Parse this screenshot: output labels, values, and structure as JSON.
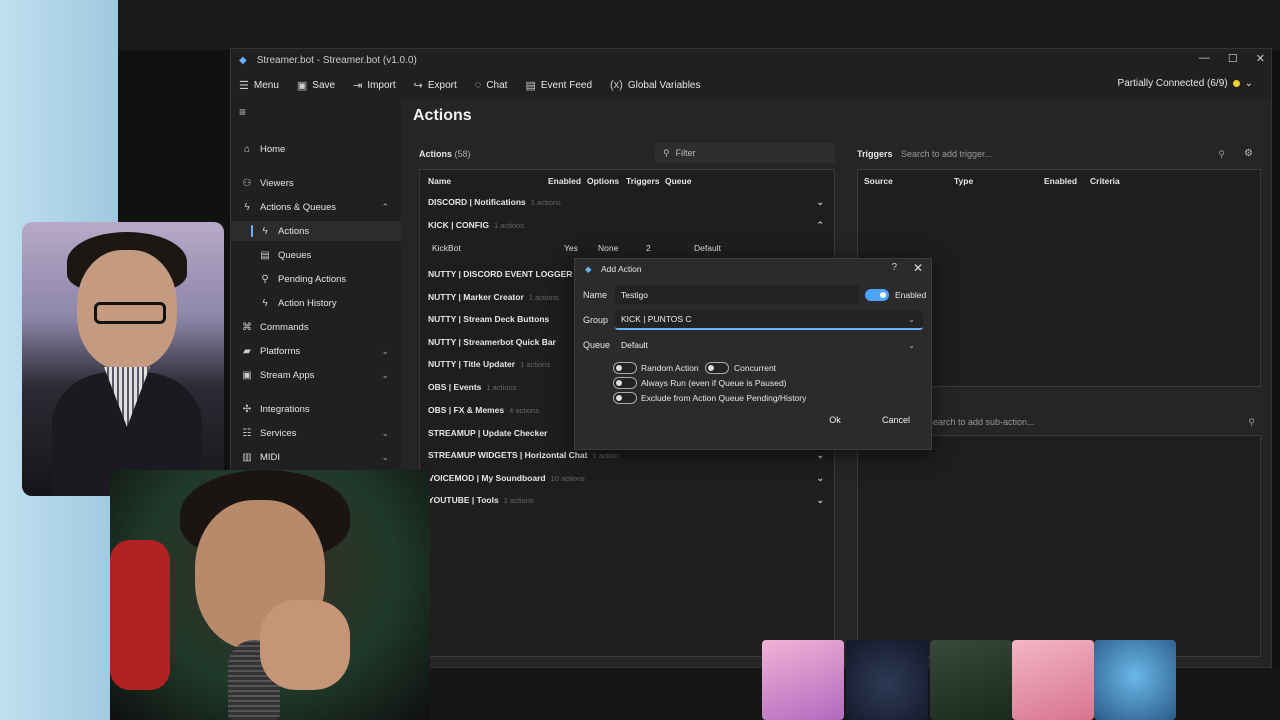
{
  "window": {
    "title": "Streamer.bot - Streamer.bot (v1.0.0)",
    "connection_status": "Partially Connected (6/9)"
  },
  "menu": {
    "items": [
      "Menu",
      "Save",
      "Import",
      "Export",
      "Chat",
      "Event Feed",
      "Global Variables"
    ]
  },
  "sidebar": {
    "items": [
      {
        "label": "Home",
        "icon": "home-icon"
      },
      {
        "label": "Viewers",
        "icon": "users-icon"
      },
      {
        "label": "Actions & Queues",
        "icon": "actions-icon",
        "expanded": true
      },
      {
        "label": "Actions",
        "icon": "bolt-icon",
        "sub": true,
        "active": true
      },
      {
        "label": "Queues",
        "icon": "queue-icon",
        "sub": true
      },
      {
        "label": "Pending Actions",
        "icon": "pending-icon",
        "sub": true
      },
      {
        "label": "Action History",
        "icon": "history-icon",
        "sub": true
      },
      {
        "label": "Commands",
        "icon": "command-icon"
      },
      {
        "label": "Platforms",
        "icon": "platforms-icon"
      },
      {
        "label": "Stream Apps",
        "icon": "apps-icon"
      },
      {
        "label": "Integrations",
        "icon": "integrations-icon"
      },
      {
        "label": "Services",
        "icon": "services-icon"
      },
      {
        "label": "MIDI",
        "icon": "midi-icon"
      }
    ]
  },
  "page_title": "Actions",
  "actions_panel": {
    "label": "Actions",
    "count": "(58)",
    "filter_placeholder": "Filter",
    "columns": [
      "Name",
      "Enabled",
      "Options",
      "Triggers",
      "Queue"
    ],
    "groups": [
      {
        "name": "DISCORD | Notifications",
        "count": "1 actions",
        "expanded": false
      },
      {
        "name": "KICK | CONFIG",
        "count": "1 actions",
        "expanded": true
      },
      {
        "name": "NUTTY | DISCORD EVENT LOGGER",
        "count": "",
        "expanded": false
      },
      {
        "name": "NUTTY | Marker Creator",
        "count": "1 actions",
        "expanded": false
      },
      {
        "name": "NUTTY | Stream Deck Buttons",
        "count": "",
        "expanded": false
      },
      {
        "name": "NUTTY | Streamerbot Quick Bar",
        "count": "",
        "expanded": false
      },
      {
        "name": "NUTTY | Title Updater",
        "count": "1 actions",
        "expanded": false
      },
      {
        "name": "OBS | Events",
        "count": "1 actions",
        "expanded": false
      },
      {
        "name": "OBS | FX & Memes",
        "count": "4 actions",
        "expanded": false
      },
      {
        "name": "STREAMUP | Update Checker",
        "count": "",
        "expanded": false
      },
      {
        "name": "STREAMUP WIDGETS | Horizontal Chat",
        "count": "1 action",
        "expanded": false
      },
      {
        "name": "VOICEMOD | My Soundboard",
        "count": "10 actions",
        "expanded": false
      },
      {
        "name": "YOUTUBE | Tools",
        "count": "1 actions",
        "expanded": false
      }
    ],
    "kick_row": {
      "name": "KickBot",
      "enabled": "Yes",
      "options": "None",
      "triggers": "2",
      "queue": "Default"
    }
  },
  "triggers_panel": {
    "label": "Triggers",
    "search_placeholder": "Search to add trigger...",
    "columns": [
      "Source",
      "Type",
      "Enabled",
      "Criteria"
    ]
  },
  "subactions_panel": {
    "search_placeholder": "Search to add sub-action..."
  },
  "dialog": {
    "title": "Add Action",
    "name_label": "Name",
    "name_value": "Testigo",
    "enabled_label": "Enabled",
    "group_label": "Group",
    "group_value": "KICK | PUNTOS C",
    "queue_label": "Queue",
    "queue_value": "Default",
    "options": [
      {
        "label": "Random Action",
        "on": false
      },
      {
        "label": "Concurrent",
        "on": false
      },
      {
        "label": "Always Run (even if Queue is Paused)",
        "on": false
      },
      {
        "label": "Exclude from Action Queue Pending/History",
        "on": false
      }
    ],
    "ok_label": "Ok",
    "cancel_label": "Cancel"
  },
  "colors": {
    "accent": "#4aa3ff",
    "status_dot": "#f0d020",
    "panel_bg": "#1e1e1e"
  }
}
